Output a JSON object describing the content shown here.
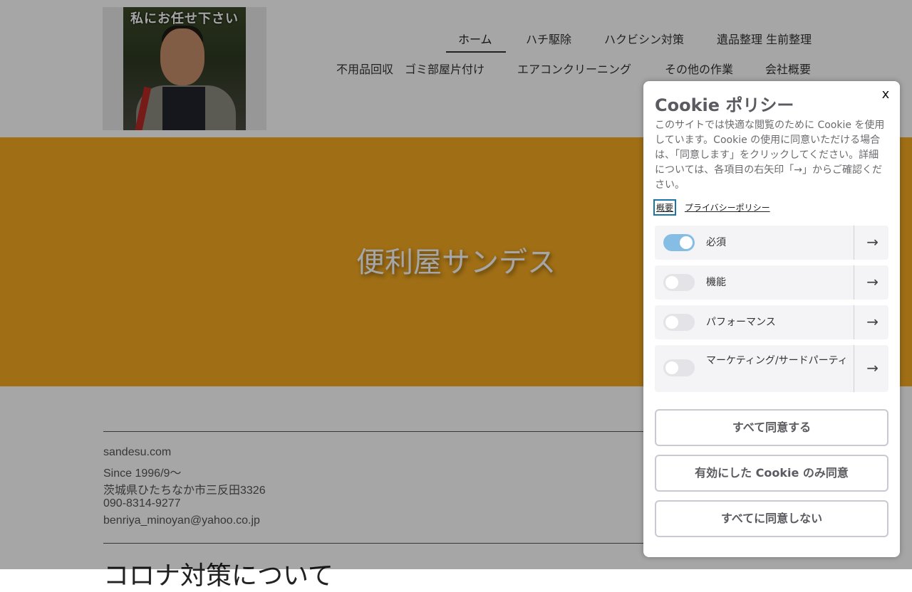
{
  "header": {
    "logo_caption": "私にお任せ下さい",
    "nav_row1": [
      "ホーム",
      "ハチ駆除",
      "ハクビシン対策",
      "遺品整理 生前整理"
    ],
    "nav_row2": [
      "不用品回収　ゴミ部屋片付け",
      "エアコンクリーニング",
      "その他の作業",
      "会社概要"
    ]
  },
  "hero": {
    "title": "便利屋サンデス",
    "color": "#f4a921"
  },
  "info": {
    "lines": [
      "sandesu.com",
      "Since 1996/9〜",
      "茨城県ひたちなか市三反田3326",
      "090-8314-9277",
      "benriya_minoyan@yahoo.co.jp"
    ],
    "next_heading": "コロナ対策について"
  },
  "cookie": {
    "close": "x",
    "title": "Cookie ポリシー",
    "description": "このサイトでは快適な閲覧のために Cookie を使用しています。Cookie の使用に同意いただける場合は、「同意します」をクリックしてください。詳細については、各項目の右矢印「→」からご確認ください。",
    "tabs": [
      "概要",
      "プライバシーポリシー"
    ],
    "categories": [
      {
        "label": "必須",
        "enabled": true
      },
      {
        "label": "機能",
        "enabled": false
      },
      {
        "label": "パフォーマンス",
        "enabled": false
      },
      {
        "label": "マーケティング/サードパーティ",
        "enabled": false
      }
    ],
    "arrow": "→",
    "buttons": {
      "accept_all": "すべて同意する",
      "accept_selected": "有効にした Cookie のみ同意",
      "reject_all": "すべてに同意しない"
    },
    "toggle_on_color": "#85bde5",
    "tab_focus_color": "#1a74a6"
  }
}
